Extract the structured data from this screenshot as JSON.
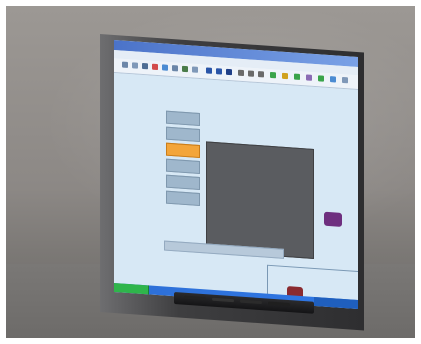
{
  "scene": {
    "colors": {
      "screen_bg": "#cfe4f3",
      "dialog_bg": "#5a5c60",
      "active_tab": "#f3a53a",
      "taskbar": "#2d6fd6",
      "start_button": "#2fb54b"
    }
  },
  "ui": {
    "dialog": {
      "heading": "",
      "rows": [
        "",
        "",
        "",
        "",
        "",
        "",
        "",
        "",
        "",
        ""
      ]
    },
    "tabs": [
      "",
      "",
      "",
      "",
      "",
      ""
    ]
  }
}
